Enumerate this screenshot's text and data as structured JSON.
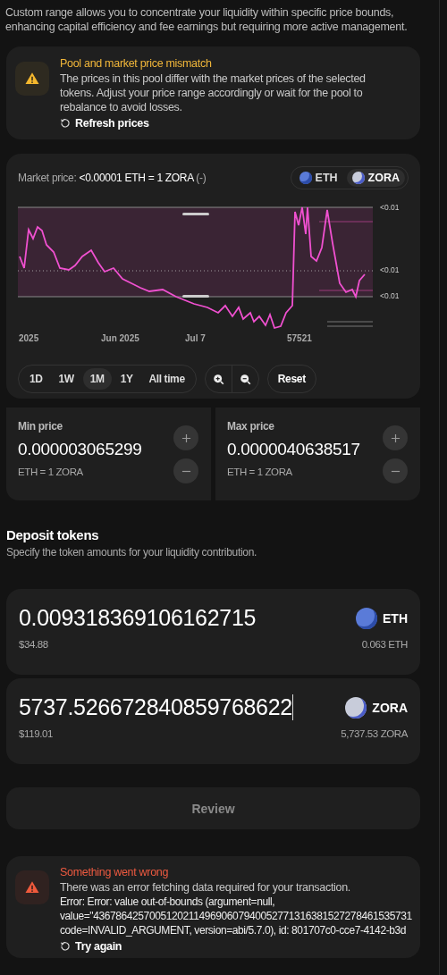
{
  "intro": "Custom range allows you to concentrate your liquidity within specific price bounds, enhancing capital efficiency and fee earnings but requiring more active management.",
  "warning": {
    "title": "Pool and market price mismatch",
    "body": "The prices in this pool differ with the market prices of the selected tokens. Adjust your price range accordingly or wait for the pool to rebalance to avoid losses.",
    "action": "Refresh prices"
  },
  "chart": {
    "label": "Market price:",
    "price": "<0.00001 ETH = 1 ZORA",
    "suffix": "(-)",
    "tokens": [
      {
        "symbol": "ETH",
        "selected": false
      },
      {
        "symbol": "ZORA",
        "selected": true
      }
    ],
    "y_labels": [
      "<0.01",
      "<0.01",
      "<0.01"
    ],
    "x_labels": [
      "2025",
      "Jun 2025",
      "Jul 7",
      "57521"
    ],
    "ranges": [
      {
        "label": "1D",
        "selected": false
      },
      {
        "label": "1W",
        "selected": false
      },
      {
        "label": "1M",
        "selected": true
      },
      {
        "label": "1Y",
        "selected": false
      },
      {
        "label": "All time",
        "selected": false
      }
    ],
    "reset": "Reset"
  },
  "prices": [
    {
      "label": "Min price",
      "value": "0.000003065299",
      "unit": "ETH = 1 ZORA"
    },
    {
      "label": "Max price",
      "value": "0.0000040638517",
      "unit": "ETH = 1 ZORA"
    }
  ],
  "deposit": {
    "title": "Deposit tokens",
    "subtitle": "Specify the token amounts for your liquidity contribution.",
    "tokens": [
      {
        "amount": "0.009318369106162715",
        "usd": "$34.88",
        "symbol": "ETH",
        "balance": "0.063 ETH",
        "focused": false
      },
      {
        "amount": "5737.526672840859768622",
        "usd": "$119.01",
        "symbol": "ZORA",
        "balance": "5,737.53 ZORA",
        "focused": true
      }
    ]
  },
  "review": {
    "label": "Review",
    "disabled": true
  },
  "error": {
    "title": "Something went wrong",
    "body": "There was an error fetching data required for your transaction.",
    "details": [
      "Error: Error: value out-of-bounds (argument=null,",
      "value=\"436786425700512021149690607940052771316381527278461535731",
      "code=INVALID_ARGUMENT, version=abi/5.7.0), id: 801707c0-cce7-4142-b3d"
    ],
    "action": "Try again"
  }
}
